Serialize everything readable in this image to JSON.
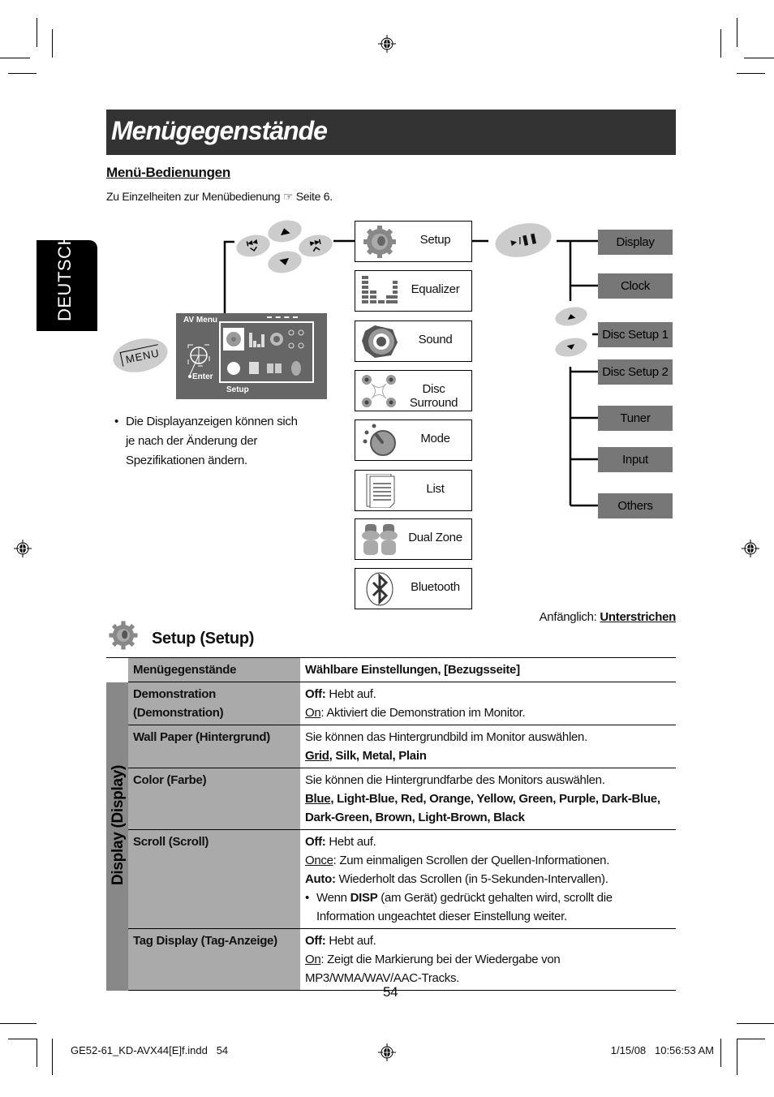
{
  "page": {
    "title": "Menügegenstände",
    "language_tab": "DEUTSCH",
    "section_heading": "Menü-Bedienungen",
    "intro_text": "Zu Einzelheiten zur Menübedienung",
    "intro_ref_icon": "pointing-hand-icon",
    "intro_ref": "Seite 6.",
    "page_number": "54",
    "footer_file": "GE52-61_KD-AVX44[E]f.indd   54",
    "footer_date": "1/15/08   10:56:53 AM"
  },
  "diagram": {
    "menu_button": "MENU",
    "prev_button_icon": "skip-back-icon",
    "next_button_icon": "skip-forward-icon",
    "up_button_icon": "triangle-up-icon",
    "down_button_icon": "triangle-down-icon",
    "play_pause_button": "►/❚❚",
    "av_screen": {
      "title": "AV Menu",
      "enter_label": "Enter",
      "selected_label": "Setup"
    },
    "menu_items": [
      {
        "label": "Setup",
        "icon": "gear-icon"
      },
      {
        "label": "Equalizer",
        "icon": "equalizer-icon"
      },
      {
        "label": "Sound",
        "icon": "speaker-icon"
      },
      {
        "label": "Disc Surround",
        "icon": "surround-icon"
      },
      {
        "label": "Mode",
        "icon": "dial-icon"
      },
      {
        "label": "List",
        "icon": "list-icon"
      },
      {
        "label": "Dual Zone",
        "icon": "dual-zone-icon"
      },
      {
        "label": "Bluetooth",
        "icon": "bluetooth-icon"
      }
    ],
    "sub_items": [
      "Display",
      "Clock",
      "Disc Setup 1",
      "Disc Setup 2",
      "Tuner",
      "Input",
      "Others"
    ],
    "note": "Die Displayanzeigen können sich je nach der Änderung der Spezifikationen ändern."
  },
  "setup_section": {
    "heading": "Setup (Setup)",
    "initial_note_label": "Anfänglich:",
    "initial_note_value": "Unterstrichen",
    "side_label": "Display (Display)",
    "columns": [
      "Menügegenstände",
      "Wählbare Einstellungen, [Bezugsseite]"
    ],
    "rows": [
      {
        "item": "Demonstration (Demonstration)",
        "lines": [
          {
            "key": "Off",
            "text": "Hebt auf."
          },
          {
            "key": "On",
            "text": "Aktiviert die Demonstration im Monitor."
          }
        ]
      },
      {
        "item": "Wall Paper (Hintergrund)",
        "desc": "Sie können das Hintergrundbild im Monitor auswählen.",
        "options": [
          "Grid",
          "Silk",
          "Metal",
          "Plain"
        ]
      },
      {
        "item": "Color (Farbe)",
        "desc": "Sie können die Hintergrundfarbe des Monitors auswählen.",
        "options": [
          "Blue",
          "Light-Blue",
          "Red",
          "Orange",
          "Yellow",
          "Green",
          "Purple",
          "Dark-Blue",
          "Dark-Green",
          "Brown",
          "Light-Brown",
          "Black"
        ]
      },
      {
        "item": "Scroll (Scroll)",
        "lines": [
          {
            "key": "Off",
            "text": "Hebt auf."
          },
          {
            "key": "Once",
            "text": "Zum einmaligen Scrollen der Quellen-Informationen."
          },
          {
            "key": "Auto",
            "text": "Wiederholt das Scrollen (in 5-Sekunden-Intervallen)."
          }
        ],
        "note_pre": "Wenn",
        "note_key": "DISP",
        "note_post": "(am Gerät) gedrückt gehalten wird, scrollt die Information ungeachtet dieser Einstellung weiter."
      },
      {
        "item": "Tag Display (Tag-Anzeige)",
        "lines": [
          {
            "key": "Off",
            "text": "Hebt auf."
          },
          {
            "key": "On",
            "text": "Zeigt die Markierung bei der Wiedergabe von MP3/WMA/WAV/AAC-Tracks."
          }
        ]
      }
    ]
  }
}
